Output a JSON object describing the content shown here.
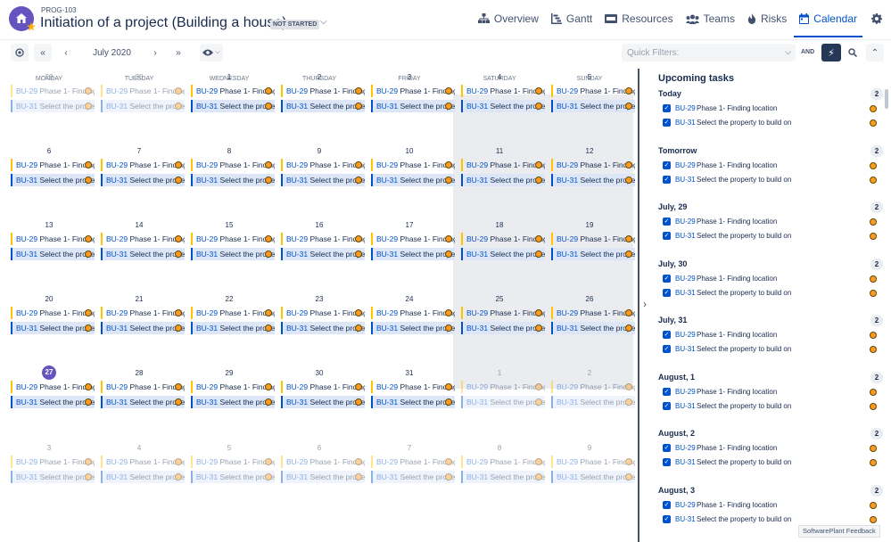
{
  "header": {
    "project_key": "PROG-103",
    "title": "Initiation of a project (Building a house)",
    "status": "NOT STARTED",
    "nav": [
      {
        "label": "Overview",
        "icon": "hierarchy-icon"
      },
      {
        "label": "Gantt",
        "icon": "gantt-icon"
      },
      {
        "label": "Resources",
        "icon": "resources-icon"
      },
      {
        "label": "Teams",
        "icon": "teams-icon"
      },
      {
        "label": "Risks",
        "icon": "risks-icon"
      },
      {
        "label": "Calendar",
        "icon": "calendar-icon",
        "active": true
      }
    ]
  },
  "toolbar": {
    "month": "July 2020",
    "quick_filters_placeholder": "Quick Filters:",
    "and_label": "AND"
  },
  "calendar": {
    "weekdays": [
      "MONDAY",
      "TUESDAY",
      "WEDNESDAY",
      "THURSDAY",
      "FRIDAY",
      "SATURDAY",
      "SUNDAY"
    ],
    "weeks": [
      [
        "29",
        "30",
        "1",
        "2",
        "3",
        "4",
        "5"
      ],
      [
        "6",
        "7",
        "8",
        "9",
        "10",
        "11",
        "12"
      ],
      [
        "13",
        "14",
        "15",
        "16",
        "17",
        "18",
        "19"
      ],
      [
        "20",
        "21",
        "22",
        "23",
        "24",
        "25",
        "26"
      ],
      [
        "27",
        "28",
        "29",
        "30",
        "31",
        "1",
        "2"
      ],
      [
        "3",
        "4",
        "5",
        "6",
        "7",
        "8",
        "9"
      ]
    ],
    "today": "27",
    "task1": {
      "key": "BU-29",
      "summary": "Phase 1- Finding location"
    },
    "task2": {
      "key": "BU-31",
      "summary": "Select the property to build on"
    }
  },
  "upcoming": {
    "title": "Upcoming tasks",
    "groups": [
      {
        "name": "Today",
        "count": "2"
      },
      {
        "name": "Tomorrow",
        "count": "2"
      },
      {
        "name": "July, 29",
        "count": "2"
      },
      {
        "name": "July, 30",
        "count": "2"
      },
      {
        "name": "July, 31",
        "count": "2"
      },
      {
        "name": "August, 1",
        "count": "2"
      },
      {
        "name": "August, 2",
        "count": "2"
      },
      {
        "name": "August, 3",
        "count": "2"
      }
    ],
    "items": [
      {
        "key": "BU-29",
        "summary": "Phase 1- Finding location"
      },
      {
        "key": "BU-31",
        "summary": "Select the property to build on"
      }
    ]
  },
  "feedback": "SoftwarePlant Feedback",
  "colors": {
    "accent": "#0052cc",
    "today": "#6554c0",
    "task1_bar": "#ffc400",
    "task2_bar": "#0052cc"
  }
}
